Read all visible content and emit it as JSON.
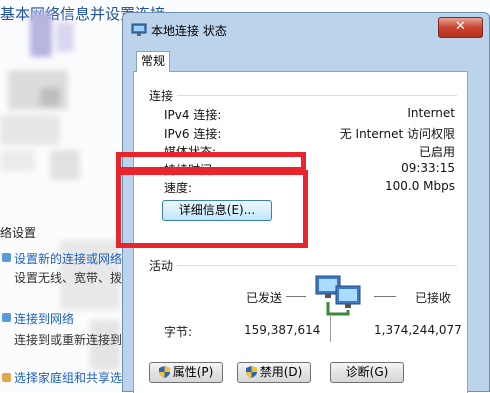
{
  "background": {
    "title": "基本网络信息并设置连接",
    "section_heading": "络设置",
    "links": [
      {
        "main": "设置新的连接或网络",
        "sub": "设置无线、宽带、拨号"
      },
      {
        "main": "连接到网络",
        "sub": "连接到或重新连接到无"
      },
      {
        "main": "选择家庭组和共享选项",
        "sub": ""
      }
    ]
  },
  "dialog": {
    "title": "本地连接 状态",
    "close_glyph": "✕",
    "tab": "常规",
    "connection": {
      "section_label": "连接",
      "rows": [
        {
          "label": "IPv4 连接:",
          "value": "Internet"
        },
        {
          "label": "IPv6 连接:",
          "value": "无 Internet 访问权限"
        },
        {
          "label": "媒体状态:",
          "value": "已启用"
        },
        {
          "label": "持续时间:",
          "value": "09:33:15"
        },
        {
          "label": "速度:",
          "value": "100.0 Mbps"
        }
      ],
      "details_button": "详细信息(E)..."
    },
    "activity": {
      "section_label": "活动",
      "sent_label": "已发送",
      "received_label": "已接收",
      "bytes_label": "字节:",
      "bytes_sent": "159,387,614",
      "bytes_received": "1,374,244,077"
    },
    "buttons": {
      "properties": "属性(P)",
      "disable": "禁用(D)",
      "diagnose": "诊断(G)"
    }
  },
  "colors": {
    "highlight_box": "#e8242c",
    "link": "#1e5ebf"
  }
}
